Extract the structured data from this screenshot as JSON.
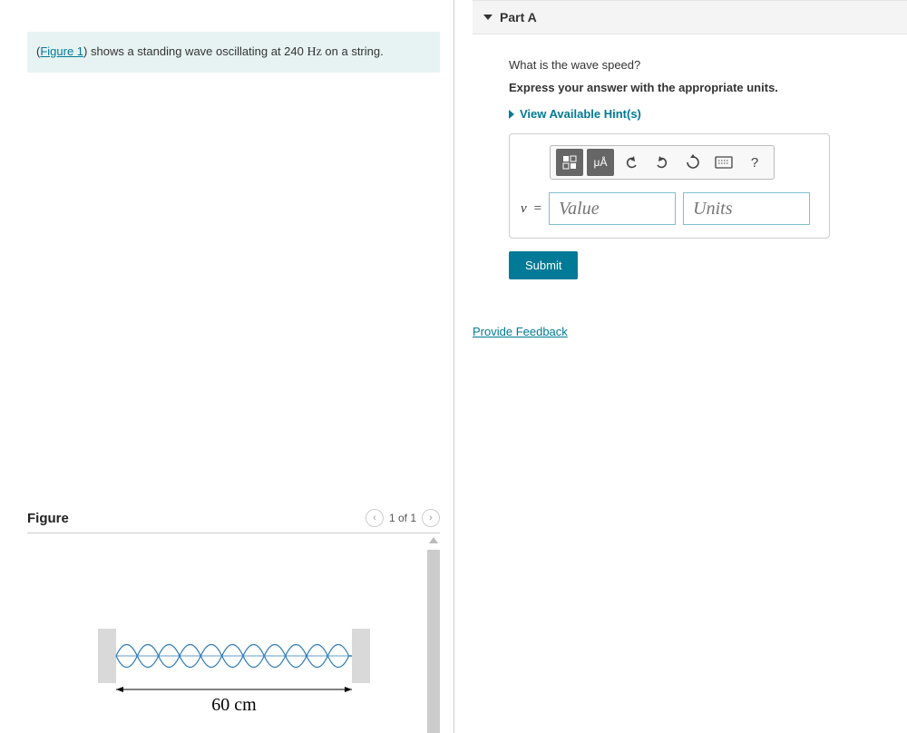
{
  "problem": {
    "figure_link": "Figure 1",
    "text_before": "(",
    "text_after_link": ") shows a standing wave oscillating at 240 ",
    "hz": "Hz",
    "text_end": " on a string."
  },
  "figure_panel": {
    "title": "Figure",
    "pager": "1 of 1",
    "dimension_label": "60 cm"
  },
  "part": {
    "title": "Part A",
    "question": "What is the wave speed?",
    "instruction": "Express your answer with the appropriate units.",
    "hints_label": "View Available Hint(s)",
    "variable": "v",
    "equals": "=",
    "value_placeholder": "Value",
    "units_placeholder": "Units",
    "submit_label": "Submit"
  },
  "feedback_link": "Provide Feedback",
  "toolbar": {
    "units_btn": "μÅ",
    "help": "?"
  }
}
